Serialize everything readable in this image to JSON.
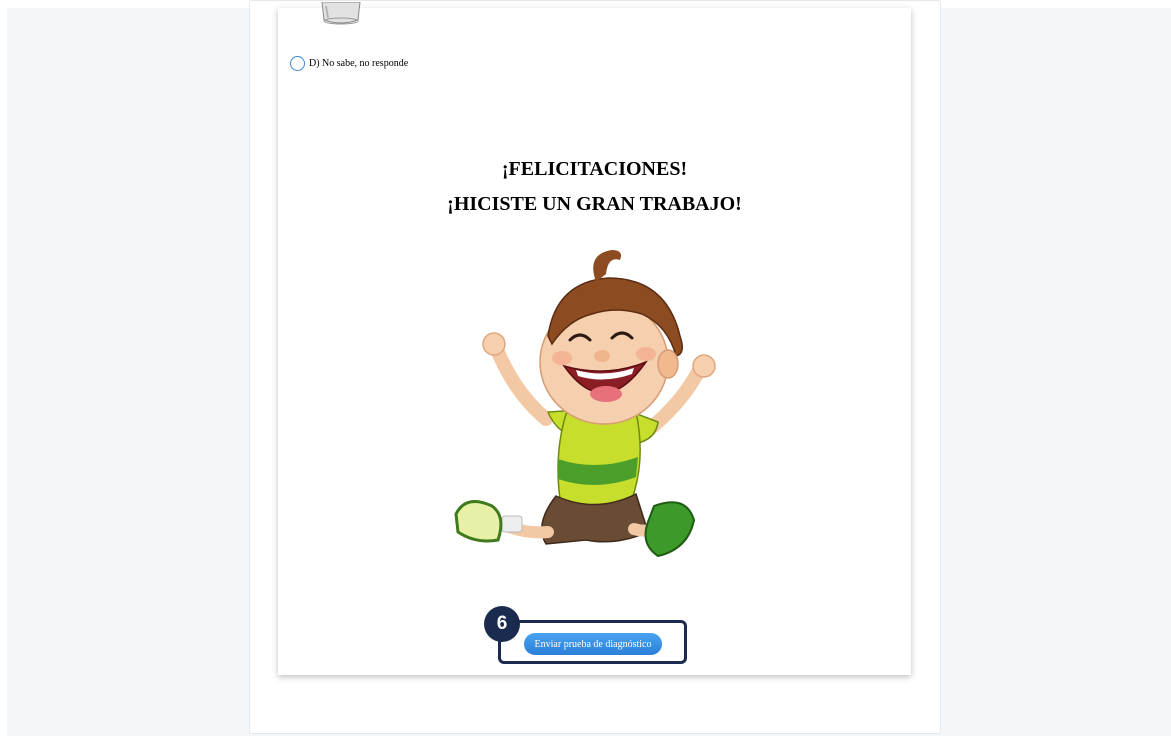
{
  "question": {
    "option_d_label": "D) No sabe, no responde"
  },
  "congrats": {
    "line1": "¡FELICITACIONES!",
    "line2": "¡HICISTE UN GRAN TRABAJO!"
  },
  "step_badge": "6",
  "submit": {
    "label": "Enviar prueba de diagnóstico"
  },
  "colors": {
    "accent_blue": "#2a7fd8",
    "highlight_navy": "#1b2b50",
    "background": "#f3f7f9"
  }
}
